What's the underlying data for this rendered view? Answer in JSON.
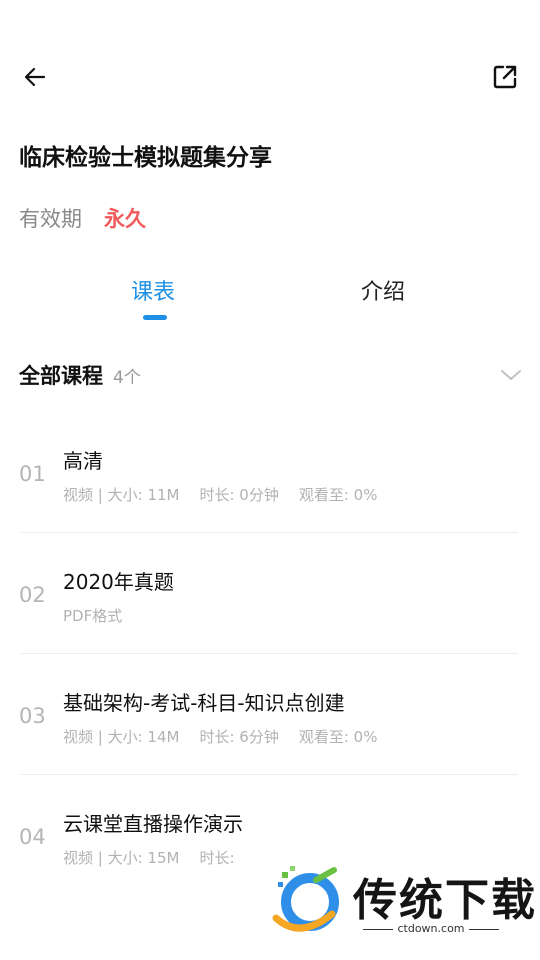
{
  "header": {
    "back_icon": "arrow-left-icon",
    "share_icon": "external-share-icon"
  },
  "course": {
    "title": "临床检验士模拟题集分享",
    "validity_label": "有效期",
    "validity_value": "永久"
  },
  "tabs": [
    {
      "label": "课表",
      "active": true
    },
    {
      "label": "介绍",
      "active": false
    }
  ],
  "section": {
    "title": "全部课程",
    "count": "4个",
    "toggle_icon": "chevron-down-icon"
  },
  "lessons": [
    {
      "num": "01",
      "title": "高清",
      "type": "视频 | 大小: 11M",
      "duration": "时长: 0分钟",
      "progress": "观看至: 0%"
    },
    {
      "num": "02",
      "title": "2020年真题",
      "type": "PDF格式",
      "duration": "",
      "progress": ""
    },
    {
      "num": "03",
      "title": "基础架构-考试-科目-知识点创建",
      "type": "视频 | 大小: 14M",
      "duration": "时长: 6分钟",
      "progress": "观看至: 0%"
    },
    {
      "num": "04",
      "title": "云课堂直播操作演示",
      "type": "视频 | 大小: 15M",
      "duration": "时长:",
      "progress": ""
    }
  ],
  "watermark": {
    "text": "传统下载",
    "sub": "ctdown.com"
  },
  "colors": {
    "accent": "#1e90e6",
    "validity_value": "#f05a5a",
    "muted": "#b2b2b2"
  }
}
